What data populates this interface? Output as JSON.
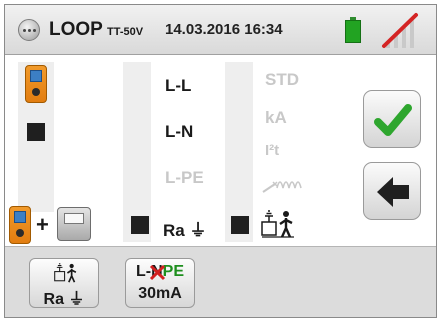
{
  "header": {
    "title": "LOOP",
    "title_sub": "TT-50V",
    "datetime": "14.03.2016 16:34",
    "battery_color": "#22a322",
    "icons": [
      "menu-icon",
      "battery-icon",
      "wireless-off-icon"
    ]
  },
  "main": {
    "left_column": {
      "icons": [
        "meter-icon",
        "meter-plus-remote-icon"
      ],
      "plus_label": "+"
    },
    "function_column": {
      "items": [
        {
          "label": "L-L",
          "active": true
        },
        {
          "label": "L-N",
          "active": true
        },
        {
          "label": "L-PE",
          "active": false
        },
        {
          "label": "Ra ⏚",
          "active": true
        }
      ]
    },
    "mode_column": {
      "items": [
        {
          "label": "STD",
          "active": false
        },
        {
          "label": "kA",
          "active": false
        },
        {
          "label": "I²t",
          "active": false
        }
      ],
      "icons": [
        "impedance-waveform-icon",
        "earth-rod-person-icon"
      ]
    },
    "side_buttons": [
      "confirm-check-icon",
      "back-arrow-icon"
    ],
    "colors": {
      "check": "#2ea62e",
      "dim_text": "#c8c8c8"
    }
  },
  "bottom": {
    "buttons": [
      {
        "line1": "",
        "line2": "Ra ⏚",
        "icon": "earth-rod-person-icon"
      },
      {
        "line1_a": "L-",
        "line1_x": "N",
        "line1_b": "PE",
        "line2": "30mA"
      }
    ],
    "colors": {
      "pe_green": "#1e8f1e",
      "cross_red": "#d32020"
    }
  }
}
